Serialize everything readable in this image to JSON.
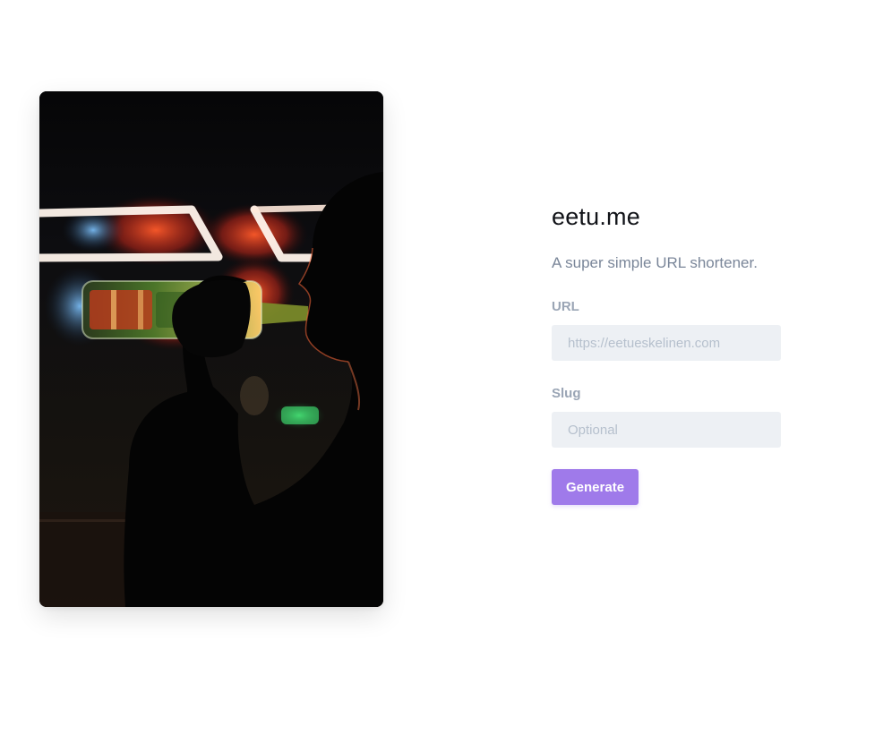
{
  "site": {
    "title": "eetu.me",
    "tagline": "A super simple URL shortener."
  },
  "photo": {
    "icon": "person-drinking-bottle-night-photo"
  },
  "form": {
    "url_label": "URL",
    "url_placeholder": "https://eetueskelinen.com",
    "url_value": "",
    "slug_label": "Slug",
    "slug_placeholder": "Optional",
    "slug_value": "",
    "submit_label": "Generate"
  },
  "colors": {
    "accent": "#9f7aea",
    "input_bg": "#edf0f4",
    "label": "#9aa5b5",
    "tagline": "#7a8699",
    "title": "#111318"
  }
}
